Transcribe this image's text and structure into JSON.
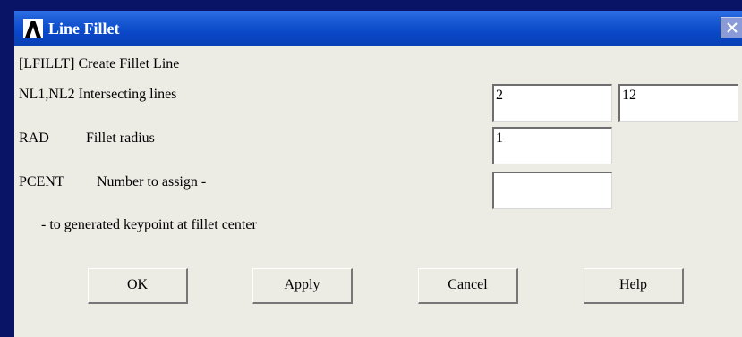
{
  "window": {
    "title": "Line Fillet",
    "title_icon": "ansys-logo-icon",
    "close_icon": "close-icon"
  },
  "form": {
    "command_line": "[LFILLT]  Create Fillet Line",
    "nl_label": "NL1,NL2  Intersecting lines",
    "nl1_value": "2",
    "nl2_value": "12",
    "rad_label": "RAD",
    "rad_desc": "Fillet radius",
    "rad_value": "1",
    "pcent_label": "PCENT",
    "pcent_desc": "Number to assign -",
    "pcent_value": "",
    "pcent_note": "- to generated keypoint at fillet center"
  },
  "buttons": {
    "ok": "OK",
    "apply": "Apply",
    "cancel": "Cancel",
    "help": "Help"
  },
  "colors": {
    "background": "#0a1466",
    "titlebar": "#0a48c8",
    "dialog": "#ecebe4"
  }
}
